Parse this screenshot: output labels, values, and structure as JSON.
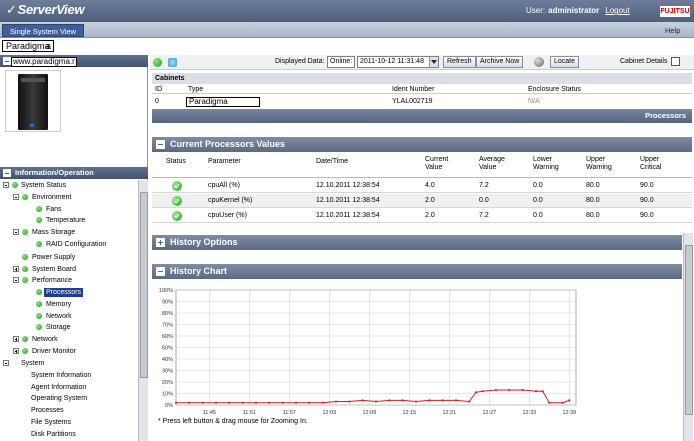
{
  "header": {
    "logo_text": "ServerView",
    "user_label": "User:",
    "user_name": "administrator",
    "logout": "Logout",
    "brand": "FUJITSU"
  },
  "nav": {
    "tab": "Single System View",
    "help": "Help"
  },
  "system_name": "Paradigma",
  "system_name_tail": "a",
  "left_panel": {
    "url": "www.paradigma.r",
    "info_header": "Information/Operation",
    "tree": [
      {
        "label": "System Status"
      },
      {
        "label": "Environment"
      },
      {
        "label": "Fans"
      },
      {
        "label": "Temperature"
      },
      {
        "label": "Mass Storage"
      },
      {
        "label": "RAID Configuration"
      },
      {
        "label": "Power Supply"
      },
      {
        "label": "System Board"
      },
      {
        "label": "Performance"
      },
      {
        "label": "Processors"
      },
      {
        "label": "Memory"
      },
      {
        "label": "Network"
      },
      {
        "label": "Storage"
      },
      {
        "label": "Network"
      },
      {
        "label": "Driver Monitor"
      },
      {
        "label": "System"
      },
      {
        "label": "System Information"
      },
      {
        "label": "Agent Information"
      },
      {
        "label": "Operating System"
      },
      {
        "label": "Processes"
      },
      {
        "label": "File Systems"
      },
      {
        "label": "Disk Partitions"
      }
    ]
  },
  "toolbar": {
    "displayed_data_label": "Displayed Data:",
    "mode_value": "Online:",
    "datetime_value": "2011-10-12 11:31:48",
    "refresh": "Refresh",
    "archive_now": "Archive Now",
    "locate": "Locate",
    "cabinet_details": "Cabinet Details"
  },
  "cabinets": {
    "title": "Cabinets",
    "columns": [
      "ID",
      "Type",
      "Ident Number",
      "Enclosure Status"
    ],
    "row": {
      "id": "0",
      "type": "Paradigma",
      "ident": "YLAL002719",
      "status": "N/A"
    }
  },
  "breadcrumb": "Processors",
  "current_values": {
    "title": "Current Processors Values",
    "columns": [
      "Status",
      "Parameter",
      "Date/Time",
      "Current Value",
      "Average Value",
      "Lower Warning",
      "Upper Warning",
      "Upper Critical"
    ],
    "rows": [
      {
        "param": "cpuAll (%)",
        "datetime": "12.10.2011 12:38:54",
        "current": "4.0",
        "average": "7.2",
        "lower": "0.0",
        "upper_warn": "80.0",
        "upper_crit": "90.0"
      },
      {
        "param": "cpuKernel (%)",
        "datetime": "12.10.2011 12:38:54",
        "current": "2.0",
        "average": "0.0",
        "lower": "0.0",
        "upper_warn": "80.0",
        "upper_crit": "90.0"
      },
      {
        "param": "cpuUser (%)",
        "datetime": "12.10.2011 12:38:54",
        "current": "2.0",
        "average": "7.2",
        "lower": "0.0",
        "upper_warn": "80.0",
        "upper_crit": "90.0"
      }
    ]
  },
  "history_options": {
    "title": "History Options"
  },
  "history_chart": {
    "title": "History Chart",
    "note": "* Press left button & drag mouse for Zooming In."
  },
  "chart_data": {
    "type": "line",
    "ylim": [
      0,
      100
    ],
    "y_ticks": [
      "0%",
      "10%",
      "20%",
      "30%",
      "40%",
      "50%",
      "60%",
      "70%",
      "80%",
      "90%",
      "100%"
    ],
    "x_ticks": [
      "11:45",
      "11:51",
      "11:57",
      "12:03",
      "12:09",
      "12:15",
      "12:21",
      "12:27",
      "12:33",
      "12:39"
    ],
    "grid": true,
    "line_color": "#cc2222",
    "series": [
      {
        "x": [
          "11:40",
          "11:42",
          "11:44",
          "11:46",
          "11:48",
          "11:50",
          "11:52",
          "11:54",
          "11:56",
          "11:58",
          "12:00",
          "12:02",
          "12:04",
          "12:06",
          "12:08",
          "12:10",
          "12:12",
          "12:14",
          "12:16",
          "12:18",
          "12:20",
          "12:22",
          "12:24",
          "12:25",
          "12:26",
          "12:28",
          "12:30",
          "12:32",
          "12:34",
          "12:35",
          "12:36",
          "12:38",
          "12:39"
        ],
        "values": [
          2,
          2,
          2,
          2,
          2,
          2,
          2,
          2,
          2,
          2,
          2,
          2,
          3,
          3,
          4,
          3,
          4,
          4,
          3,
          4,
          4,
          4,
          3,
          11,
          12,
          13,
          13,
          13,
          12,
          12,
          2,
          2,
          4
        ]
      }
    ]
  }
}
